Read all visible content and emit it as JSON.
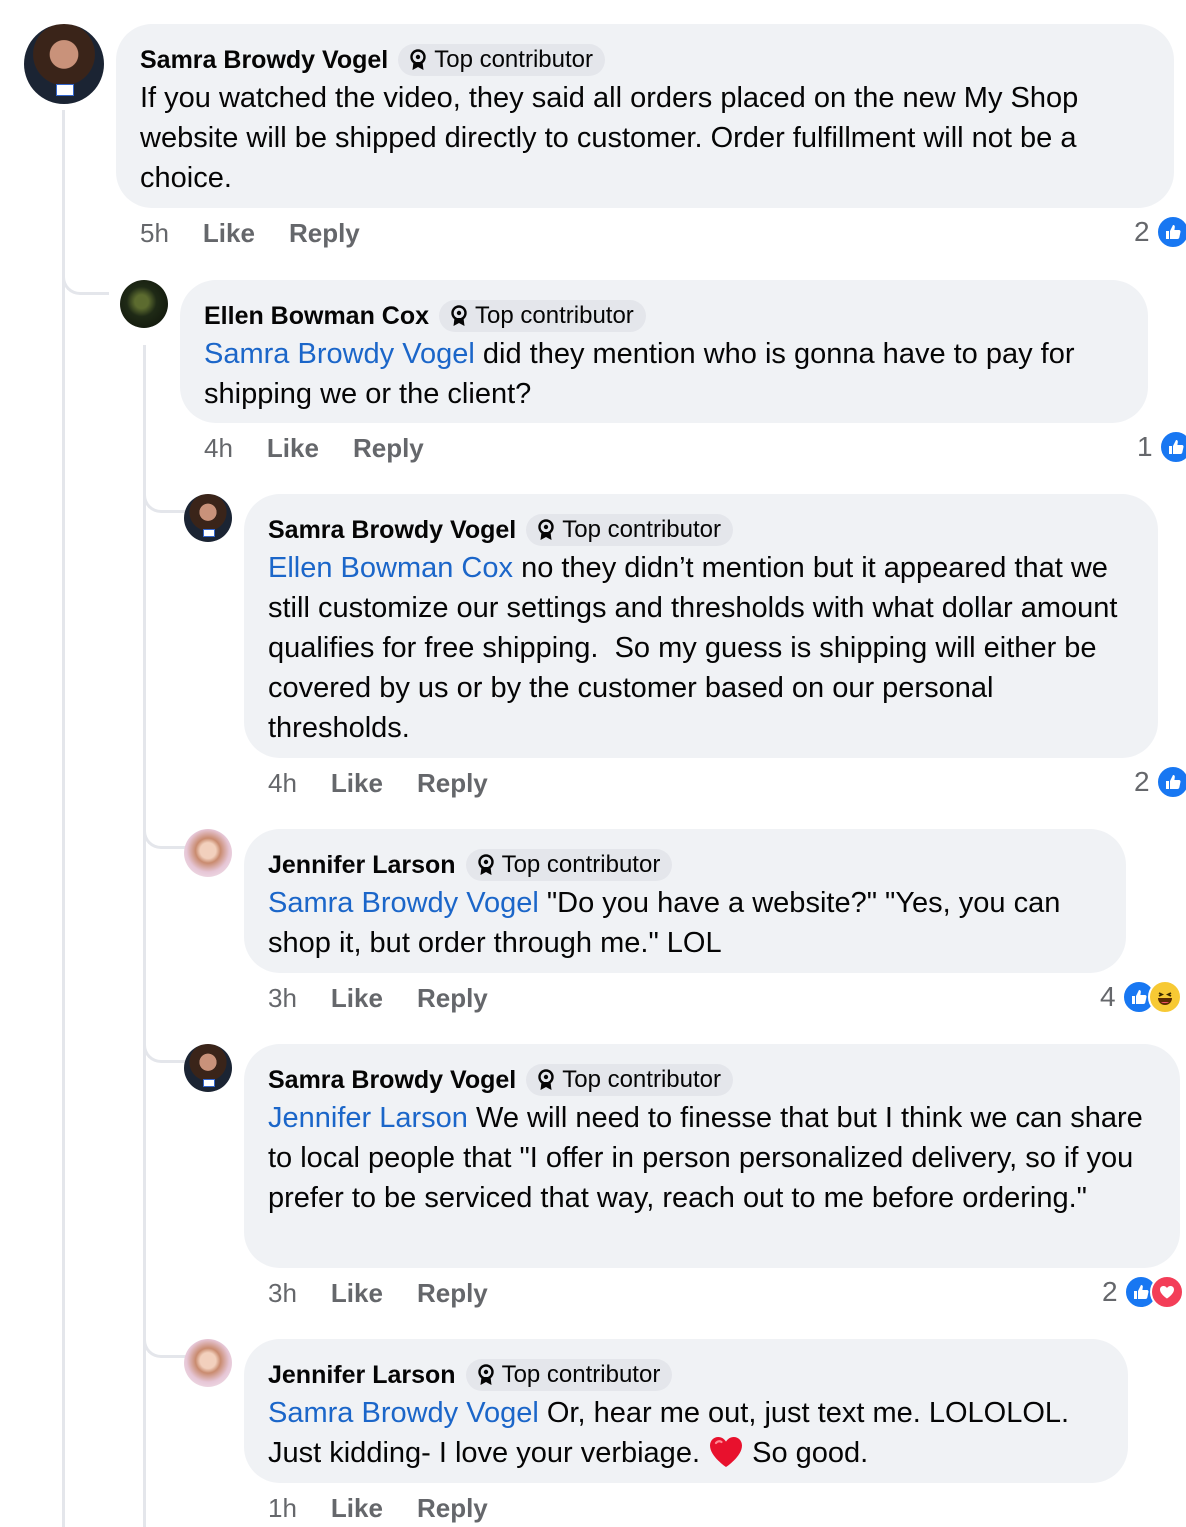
{
  "badge_label": "Top contributor",
  "actions": {
    "like": "Like",
    "reply": "Reply"
  },
  "icons": {
    "badge": "award-badge-icon",
    "like": "like-reaction-icon",
    "haha": "haha-reaction-icon",
    "love": "love-reaction-icon",
    "heart_emoji": "red-heart-emoji"
  },
  "colors": {
    "mention": "#1b66c9",
    "like": "#1877f2",
    "love": "#f33e58",
    "haha": "#f7c934",
    "bubble": "#f0f2f5"
  },
  "comments": [
    {
      "author": "Samra Browdy Vogel",
      "mention": "",
      "text": "If you watched the video, they said all orders placed on the new My Shop website will be shipped directly to customer. Order fulfillment will not be a choice.",
      "time": "5h",
      "reaction_count": "2",
      "reactions": [
        "like"
      ]
    },
    {
      "author": "Ellen Bowman Cox",
      "mention": "Samra Browdy Vogel",
      "text": "did they mention who is gonna have to pay for shipping we or the client?",
      "time": "4h",
      "reaction_count": "1",
      "reactions": [
        "like"
      ]
    },
    {
      "author": "Samra Browdy Vogel",
      "mention": "Ellen Bowman Cox",
      "text": "no they didn’t mention but it appeared that we still customize our settings and thresholds with what dollar amount qualifies for free shipping.  So my guess is shipping will either be covered by us or by the customer based on our personal thresholds.",
      "time": "4h",
      "reaction_count": "2",
      "reactions": [
        "like"
      ]
    },
    {
      "author": "Jennifer Larson",
      "mention": "Samra Browdy Vogel",
      "text": "\"Do you have a website?\" \"Yes, you can shop it, but order through me.\" LOL",
      "time": "3h",
      "reaction_count": "4",
      "reactions": [
        "like",
        "haha"
      ]
    },
    {
      "author": "Samra Browdy Vogel",
      "mention": "Jennifer Larson",
      "text": "We will need to finesse that but I think we can share to local people that \"I offer in person personalized delivery, so if you prefer to be serviced that way, reach out to me before ordering.\"",
      "time": "3h",
      "reaction_count": "2",
      "reactions": [
        "like",
        "love"
      ]
    },
    {
      "author": "Jennifer Larson",
      "mention": "Samra Browdy Vogel",
      "text": "Or, hear me out, just text me. LOLOLOL. Just kidding- I love your verbiage.",
      "text_after_emoji": "So good.",
      "time": "1h",
      "reaction_count": "",
      "reactions": []
    }
  ]
}
